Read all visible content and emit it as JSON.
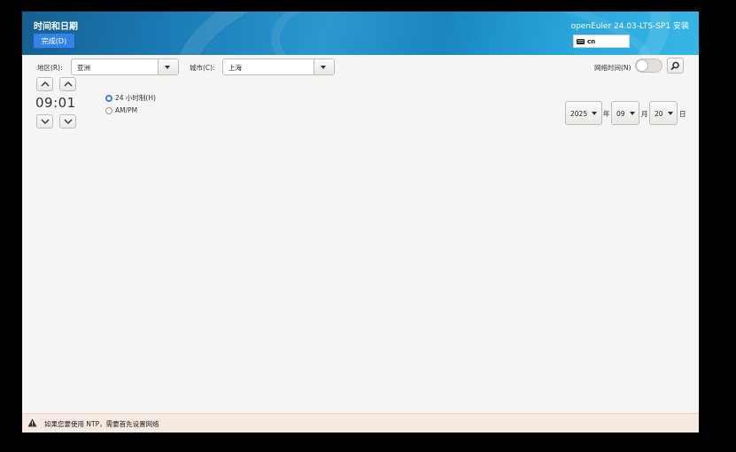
{
  "header": {
    "title": "时间和日期",
    "done_label": "完成(D)",
    "product": "openEuler 24.03-LTS-SP1 安装",
    "keyboard_layout": "cn"
  },
  "location": {
    "region_label": "地区(R):",
    "region_value": "亚洲",
    "city_label": "城市(C):",
    "city_value": "上海"
  },
  "ntp": {
    "label": "网络时间(N)",
    "enabled": false
  },
  "time": {
    "value": "09:01",
    "format_24h_label": "24 小时制(H)",
    "format_ampm_label": "AM/PM",
    "selected_format": "24h"
  },
  "date": {
    "year": "2025",
    "year_suffix": "年",
    "month": "09",
    "month_suffix": "月",
    "day": "20",
    "day_suffix": "日"
  },
  "warning": {
    "text": "如果您要使用 NTP，需要首先设置网络"
  },
  "icons": [
    "keyboard-icon",
    "gear-icon",
    "chevron-up-icon",
    "chevron-down-icon",
    "dropdown-arrow-icon",
    "warning-icon"
  ],
  "colors": {
    "accent": "#3584e4",
    "header": "#1b7bb5",
    "warning_bar": "#f5e9e0"
  }
}
